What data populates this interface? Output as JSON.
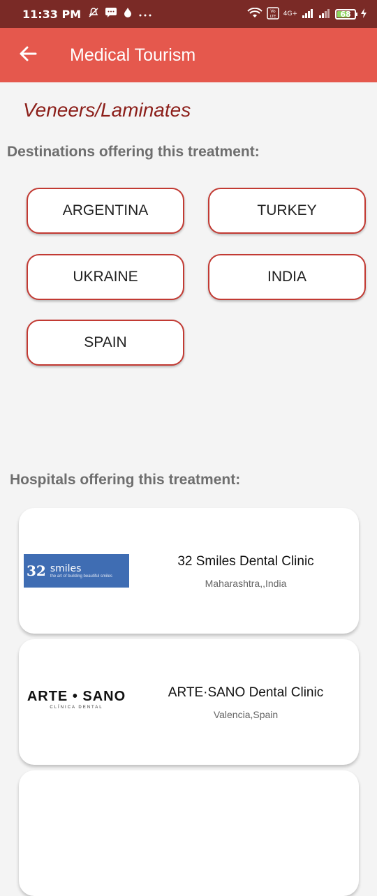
{
  "status_bar": {
    "time": "11:33 PM",
    "left_icons": [
      "mute-icon",
      "message-icon",
      "drop-icon",
      "more-icon"
    ],
    "network_label": "4G+",
    "battery_percent": "68"
  },
  "app_bar": {
    "title": "Medical Tourism",
    "back_icon": "arrow-left-icon"
  },
  "treatment": {
    "name": "Veneers/Laminates"
  },
  "destinations": {
    "heading": "Destinations offering this treatment:",
    "items": [
      "ARGENTINA",
      "TURKEY",
      "UKRAINE",
      "INDIA",
      "SPAIN"
    ]
  },
  "hospitals": {
    "heading": "Hospitals offering this treatment:",
    "items": [
      {
        "name": "32 Smiles Dental Clinic",
        "location": "Maharashtra,,India",
        "logo_main": "32",
        "logo_word": "smiles",
        "logo_tagline": "the art of building beautiful smiles"
      },
      {
        "name": "ARTE·SANO Dental Clinic",
        "location": "Valencia,Spain",
        "logo_main": "ARTE • SANO",
        "logo_tagline": "CLÍNICA DENTAL"
      }
    ]
  },
  "colors": {
    "status_bar": "#7a2a26",
    "app_bar": "#e5584d",
    "accent_border": "#c23a33",
    "treatment_title": "#8c1f1a"
  }
}
